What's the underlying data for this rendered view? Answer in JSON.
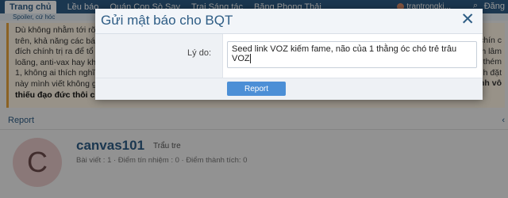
{
  "navbar": {
    "items": [
      "Trang chủ",
      "Lều báo",
      "Quán Con Sò Say",
      "Trại Sáng tác",
      "Băng Phong Thải"
    ],
    "username": "trantrongki...",
    "logout_label": "Đăng"
  },
  "subnav": {
    "text": "Spoiler, cứ hóc"
  },
  "post": {
    "lines": [
      "Dù không nhằm tới rõ T",
      "trên, khả năng các bác k",
      "đích chính trị ra để tổ n",
      "loãng, anti-vax hay khô",
      "1, không ai thích nghĩ rằ",
      "này mình viết không giữ",
      "thiếu đạo đức thôi chứ không có gì sai luật."
    ],
    "right_fragments": [
      "e chín c",
      "thích lâm",
      "ảng thém",
      "inh đặt",
      "mình vô"
    ]
  },
  "report_link": "Report",
  "user": {
    "avatar_letter": "C",
    "name": "canvas101",
    "title": "Trẩu tre",
    "stats": "Bài viết : 1 · Điểm tín nhiệm : 0 · Điểm thành tích: 0"
  },
  "modal": {
    "title": "Gửi mật báo cho BQT",
    "close_symbol": "✕",
    "reason_label": "Lý do:",
    "reason_value": "Seed link VOZ kiếm fame, não của 1 thằng óc chó trẻ trâu VOZ",
    "submit_label": "Report"
  },
  "colors": {
    "brand": "#2e5d85",
    "button": "#4c8fd6",
    "alert_border": "#e8a33c",
    "overlay": "rgba(0,0,0,0.4)"
  },
  "icons": [
    "close-icon",
    "user-avatar-icon",
    "search-icon"
  ]
}
